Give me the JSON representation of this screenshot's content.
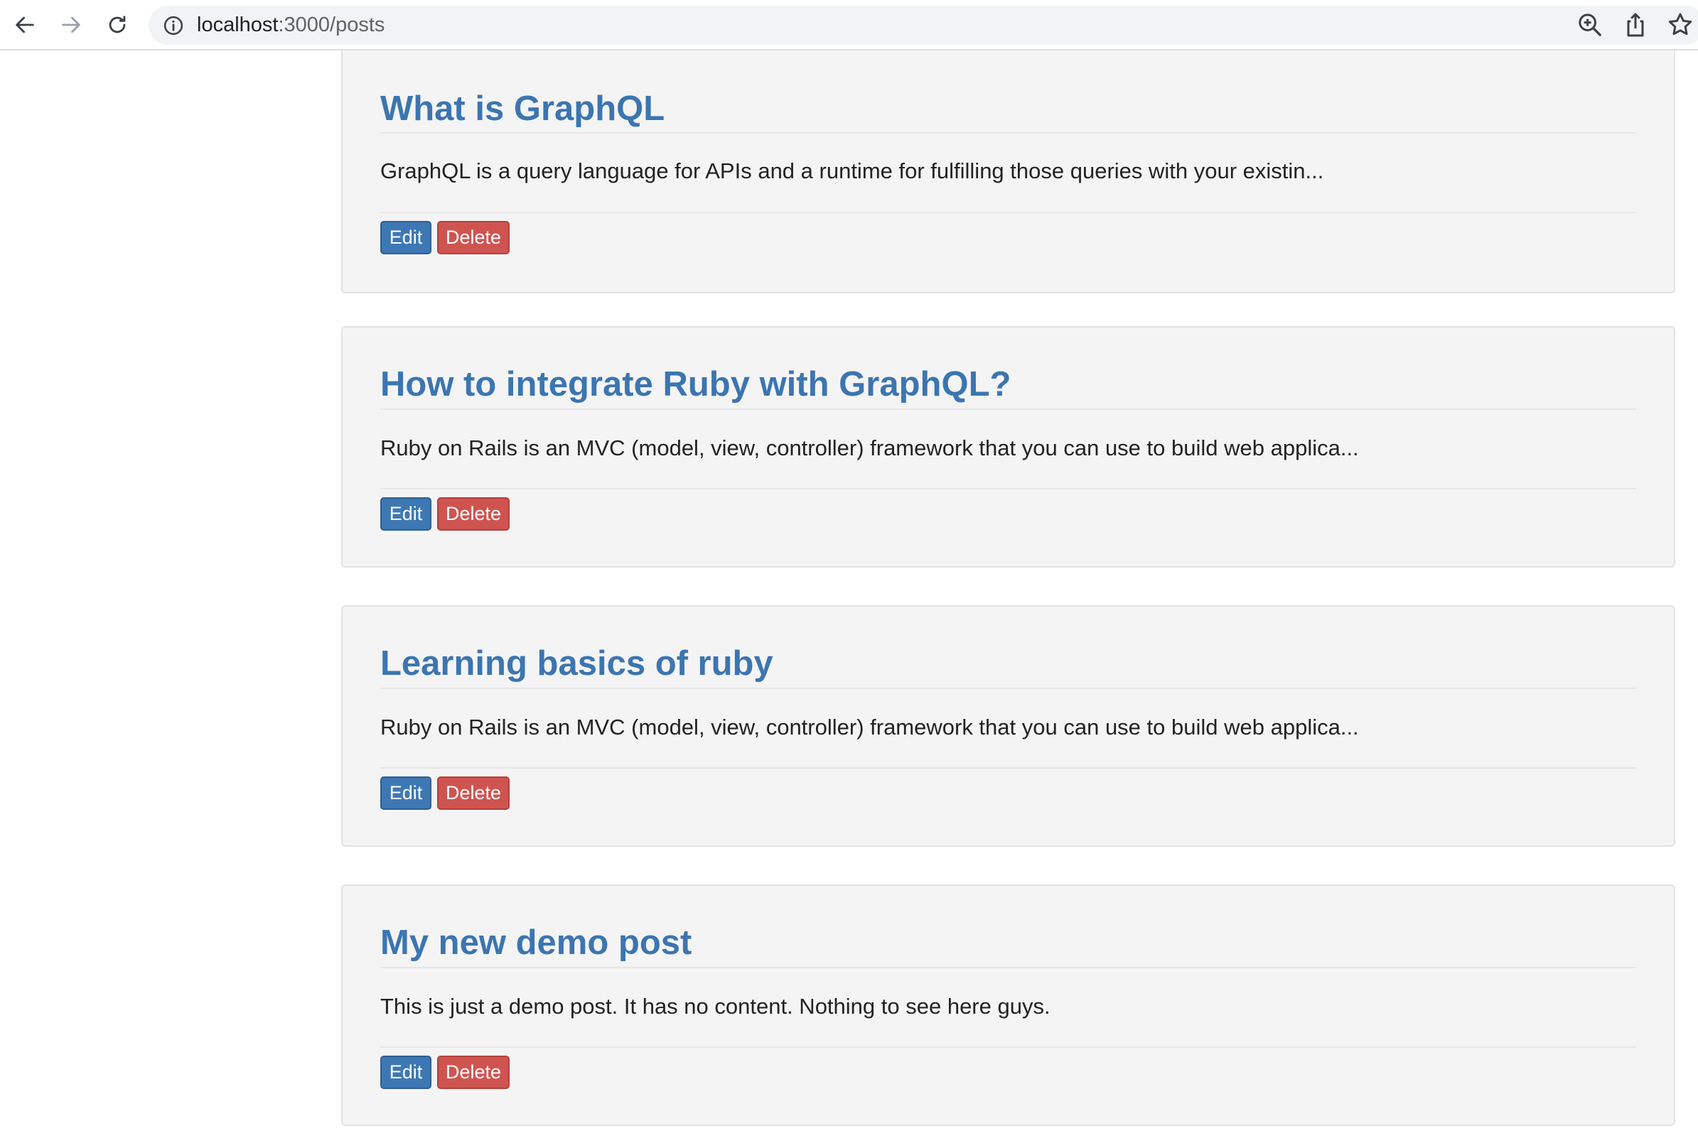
{
  "browser": {
    "url_host": "localhost",
    "url_path": ":3000/posts"
  },
  "posts": [
    {
      "title": "What is GraphQL",
      "excerpt": "GraphQL is a query language for APIs and a runtime for fulfilling those queries with your existin...",
      "edit_label": "Edit",
      "delete_label": "Delete"
    },
    {
      "title": "How to integrate Ruby with GraphQL?",
      "excerpt": "Ruby on Rails is an MVC (model, view, controller) framework that you can use to build web applica...",
      "edit_label": "Edit",
      "delete_label": "Delete"
    },
    {
      "title": "Learning basics of ruby",
      "excerpt": "Ruby on Rails is an MVC (model, view, controller) framework that you can use to build web applica...",
      "edit_label": "Edit",
      "delete_label": "Delete"
    },
    {
      "title": "My new demo post",
      "excerpt": "This is just a demo post. It has no content. Nothing to see here guys.",
      "edit_label": "Edit",
      "delete_label": "Delete"
    }
  ],
  "colors": {
    "title_link": "#3c75b0",
    "edit_button": "#3e78b4",
    "delete_button": "#cf5450",
    "card_background": "#f4f4f4"
  }
}
